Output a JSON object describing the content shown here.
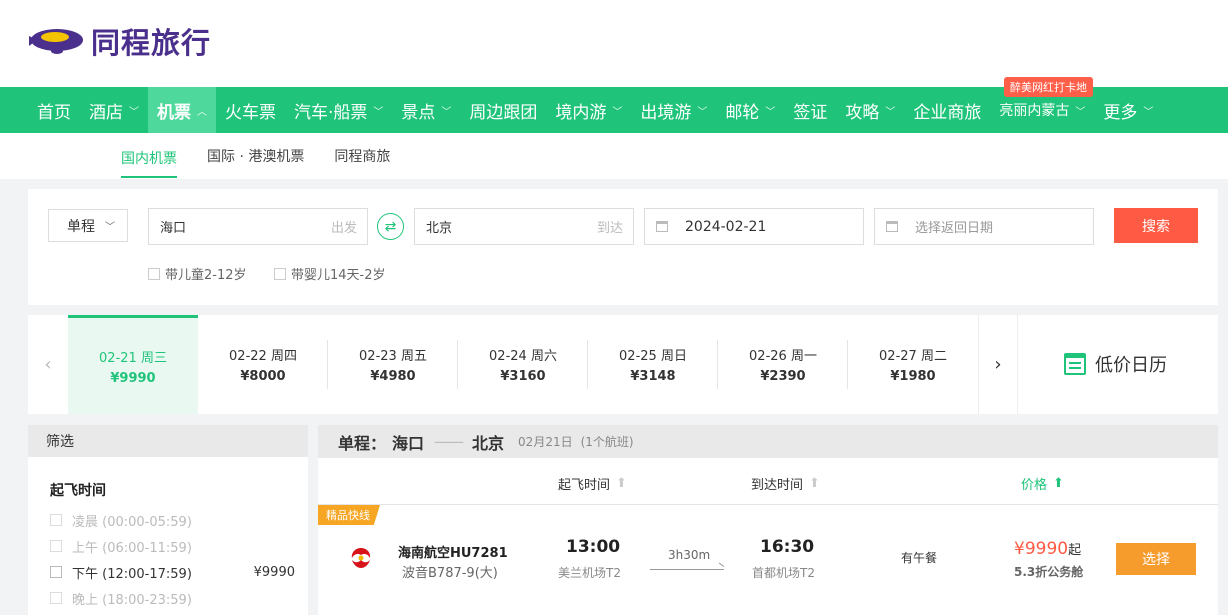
{
  "brand": {
    "logo_text": "同程旅行"
  },
  "nav": {
    "items": [
      {
        "label": "首页",
        "chevron": false
      },
      {
        "label": "酒店",
        "chevron": true
      },
      {
        "label": "机票",
        "chevron": true,
        "active": true
      },
      {
        "label": "火车票",
        "chevron": false
      },
      {
        "label": "汽车·船票",
        "chevron": true
      },
      {
        "label": "景点",
        "chevron": true
      },
      {
        "label": "周边跟团",
        "chevron": false
      },
      {
        "label": "境内游",
        "chevron": true
      },
      {
        "label": "出境游",
        "chevron": true
      },
      {
        "label": "邮轮",
        "chevron": true
      },
      {
        "label": "签证",
        "chevron": false
      },
      {
        "label": "攻略",
        "chevron": true
      },
      {
        "label": "企业商旅",
        "chevron": false
      },
      {
        "label": "亮丽内蒙古",
        "chevron": true,
        "small": true
      },
      {
        "label": "更多",
        "chevron": true
      }
    ],
    "badge": "醉美网红打卡地"
  },
  "subnav": {
    "items": [
      "国内机票",
      "国际 · 港澳机票",
      "同程商旅"
    ]
  },
  "search": {
    "trip_type": "单程",
    "from_value": "海口",
    "from_hint": "出发",
    "to_value": "北京",
    "to_hint": "到达",
    "depart_date": "2024-02-21",
    "return_placeholder": "选择返回日期",
    "search_label": "搜索",
    "child_label": "带儿童2-12岁",
    "infant_label": "带婴儿14天-2岁"
  },
  "dates": [
    {
      "date": "02-21 周三",
      "price": "¥9990"
    },
    {
      "date": "02-22 周四",
      "price": "¥8000"
    },
    {
      "date": "02-23 周五",
      "price": "¥4980"
    },
    {
      "date": "02-24 周六",
      "price": "¥3160"
    },
    {
      "date": "02-25 周日",
      "price": "¥3148"
    },
    {
      "date": "02-26 周一",
      "price": "¥2390"
    },
    {
      "date": "02-27 周二",
      "price": "¥1980"
    }
  ],
  "low_price_calendar": "低价日历",
  "filter": {
    "header": "筛选",
    "title": "起飞时间",
    "rows": [
      {
        "label": "凌晨 (00:00-05:59)",
        "price": "",
        "enabled": false
      },
      {
        "label": "上午 (06:00-11:59)",
        "price": "",
        "enabled": false
      },
      {
        "label": "下午 (12:00-17:59)",
        "price": "¥9990",
        "enabled": true
      },
      {
        "label": "晚上 (18:00-23:59)",
        "price": "",
        "enabled": false
      }
    ]
  },
  "result": {
    "prefix": "单程：",
    "from": "海口",
    "dash": "——",
    "to": "北京",
    "date": "02月21日",
    "count": "(1个航班)",
    "columns": {
      "depart": "起飞时间",
      "arrive": "到达时间",
      "price": "价格"
    },
    "flight": {
      "tag": "精品快线",
      "airline": "海南航空HU7281",
      "plane": "波音B787-9(大)",
      "depart_time": "13:00",
      "depart_airport": "美兰机场T2",
      "duration": "3h30m",
      "arrive_time": "16:30",
      "arrive_airport": "首都机场T2",
      "meal": "有午餐",
      "price": "¥9990",
      "price_suffix": "起",
      "cabin": "5.3折公务舱",
      "select_label": "选择"
    }
  },
  "colors": {
    "brand_green": "#1fc47a",
    "search_red": "#ff5a43",
    "select_orange": "#f69c2c",
    "logo_purple": "#4b2f8c"
  }
}
